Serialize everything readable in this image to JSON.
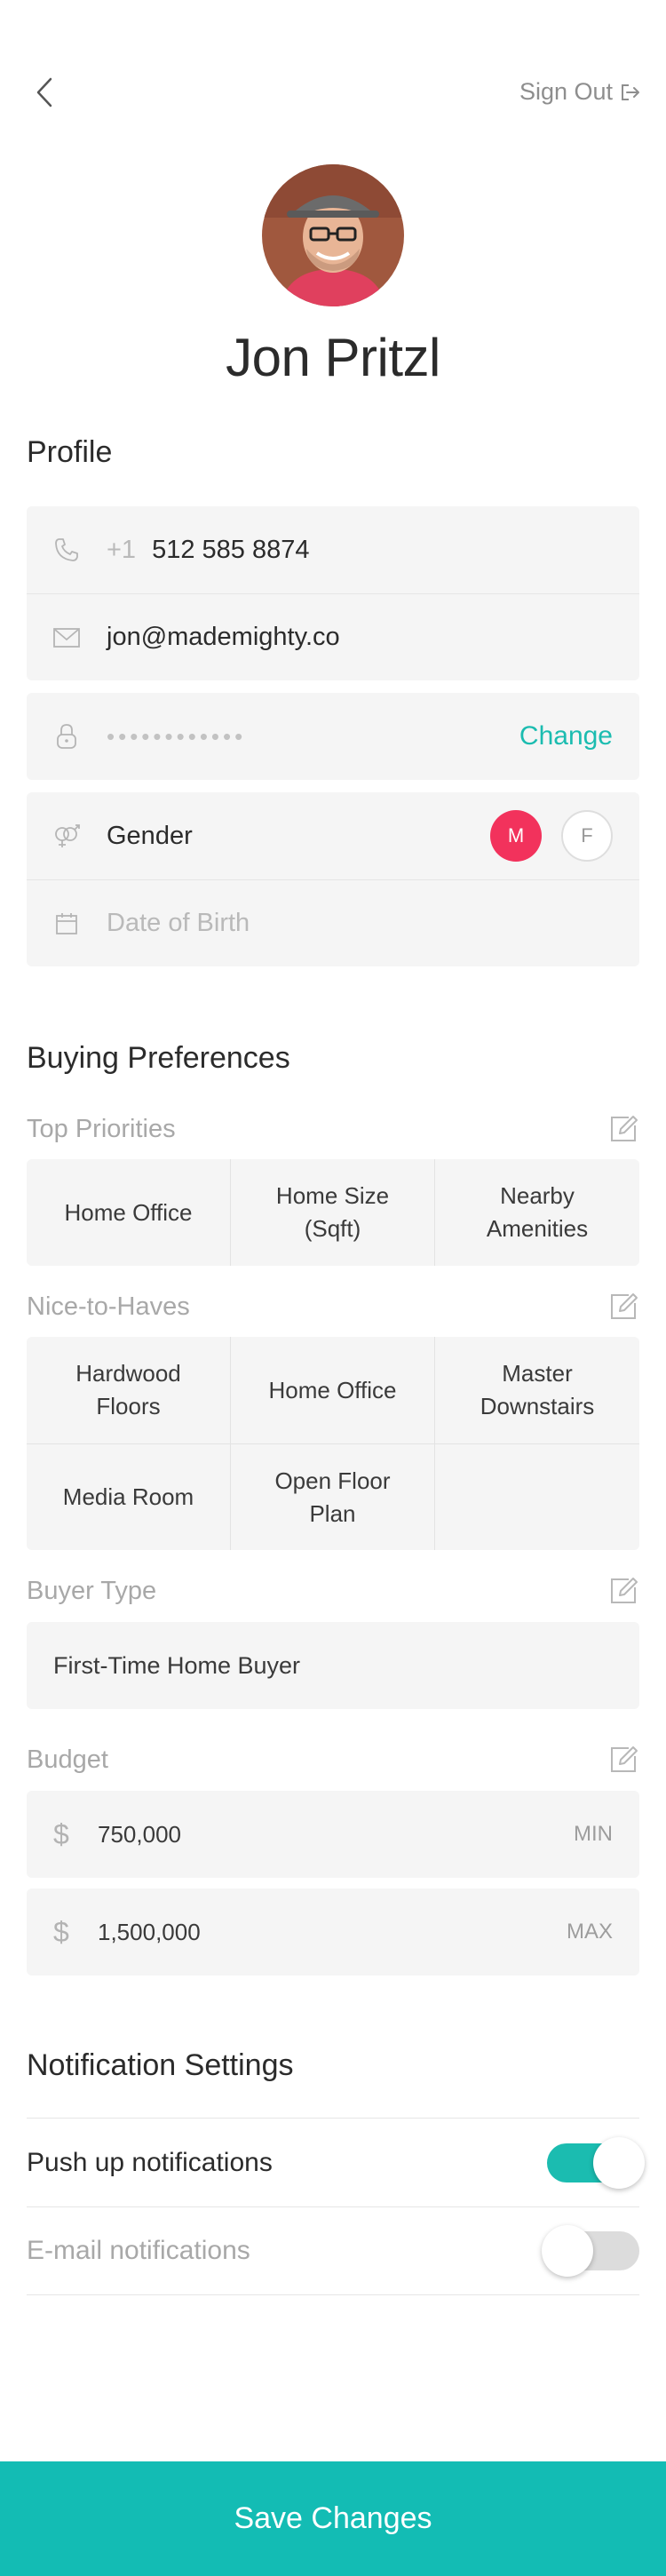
{
  "header": {
    "signout_label": "Sign Out"
  },
  "user": {
    "name": "Jon Pritzl"
  },
  "profile": {
    "title": "Profile",
    "phone_prefix": "+1",
    "phone": "512 585 8874",
    "email": "jon@mademighty.co",
    "password_mask": "••••••••••••",
    "change_label": "Change",
    "gender_label": "Gender",
    "gender_male": "M",
    "gender_female": "F",
    "dob_placeholder": "Date of Birth"
  },
  "buying": {
    "title": "Buying Preferences",
    "top_priorities": {
      "label": "Top Priorities",
      "items": [
        "Home Office",
        "Home Size (Sqft)",
        "Nearby Amenities"
      ]
    },
    "nice_to_haves": {
      "label": "Nice-to-Haves",
      "items": [
        "Hardwood Floors",
        "Home Office",
        "Master Downstairs",
        "Media Room",
        "Open Floor Plan"
      ]
    },
    "buyer_type": {
      "label": "Buyer Type",
      "value": "First-Time Home Buyer"
    },
    "budget": {
      "label": "Budget",
      "currency": "$",
      "min_value": "750,000",
      "min_tag": "MIN",
      "max_value": "1,500,000",
      "max_tag": "MAX"
    }
  },
  "notifications": {
    "title": "Notification Settings",
    "push_label": "Push up notifications",
    "push_on": true,
    "email_label": "E-mail notifications",
    "email_on": false
  },
  "footer": {
    "save_label": "Save Changes"
  },
  "colors": {
    "accent": "#1bbcb0",
    "gender_active": "#f2325c"
  }
}
